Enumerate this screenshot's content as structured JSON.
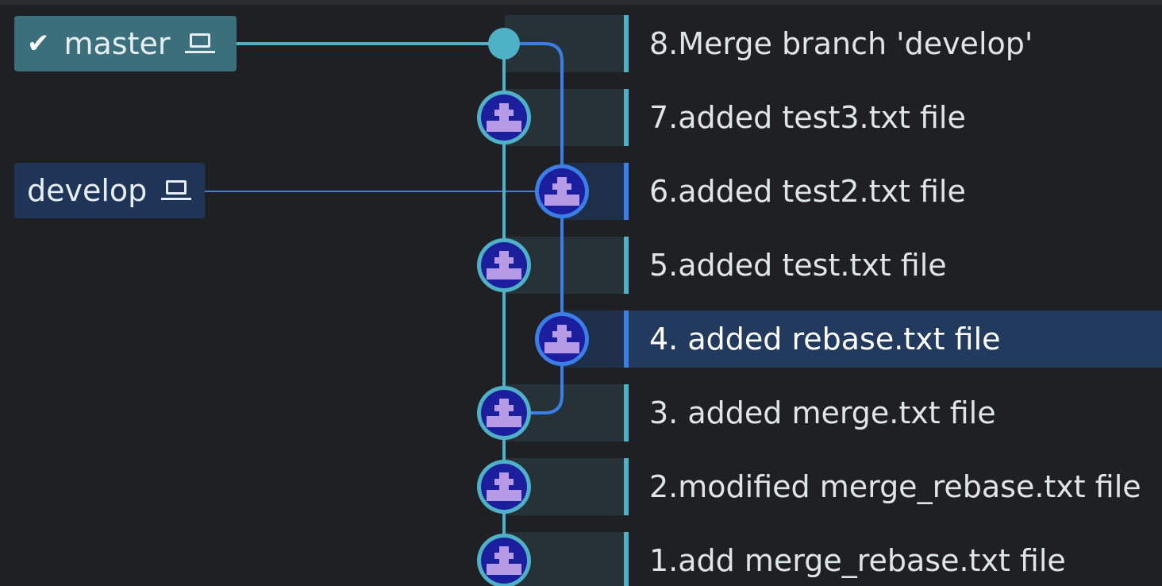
{
  "branches": {
    "master": {
      "label": "master",
      "current": true,
      "check_icon": "checkmark-icon",
      "local_icon": "laptop-icon"
    },
    "develop": {
      "label": "develop",
      "current": false,
      "local_icon": "laptop-icon"
    }
  },
  "colors": {
    "master_lane": "#4fb1c6",
    "develop_lane": "#3a7ee6",
    "master_label_bg": "#3a6f7b",
    "develop_label_bg": "#1e3558",
    "selected_row_bg": "#223a5e",
    "avatar_fill": "#1b1f9e",
    "avatar_glyph": "#b79ae6"
  },
  "commits": [
    {
      "message": "8.Merge branch 'develop'",
      "lane": "master",
      "merge": true,
      "selected": false,
      "avatar_icon": "merge-dot-icon"
    },
    {
      "message": "7.added test3.txt file",
      "lane": "master",
      "merge": false,
      "selected": false,
      "avatar_icon": "identicon-avatar-icon"
    },
    {
      "message": "6.added test2.txt file",
      "lane": "develop",
      "merge": false,
      "selected": false,
      "avatar_icon": "identicon-avatar-icon"
    },
    {
      "message": "5.added test.txt file",
      "lane": "master",
      "merge": false,
      "selected": false,
      "avatar_icon": "identicon-avatar-icon"
    },
    {
      "message": "4. added rebase.txt file",
      "lane": "develop",
      "merge": false,
      "selected": true,
      "avatar_icon": "identicon-avatar-icon"
    },
    {
      "message": "3. added merge.txt file",
      "lane": "master",
      "merge": false,
      "selected": false,
      "avatar_icon": "identicon-avatar-icon"
    },
    {
      "message": "2.modified merge_rebase.txt file",
      "lane": "master",
      "merge": false,
      "selected": false,
      "avatar_icon": "identicon-avatar-icon"
    },
    {
      "message": "1.add merge_rebase.txt file",
      "lane": "master",
      "merge": false,
      "selected": false,
      "avatar_icon": "identicon-avatar-icon"
    }
  ]
}
